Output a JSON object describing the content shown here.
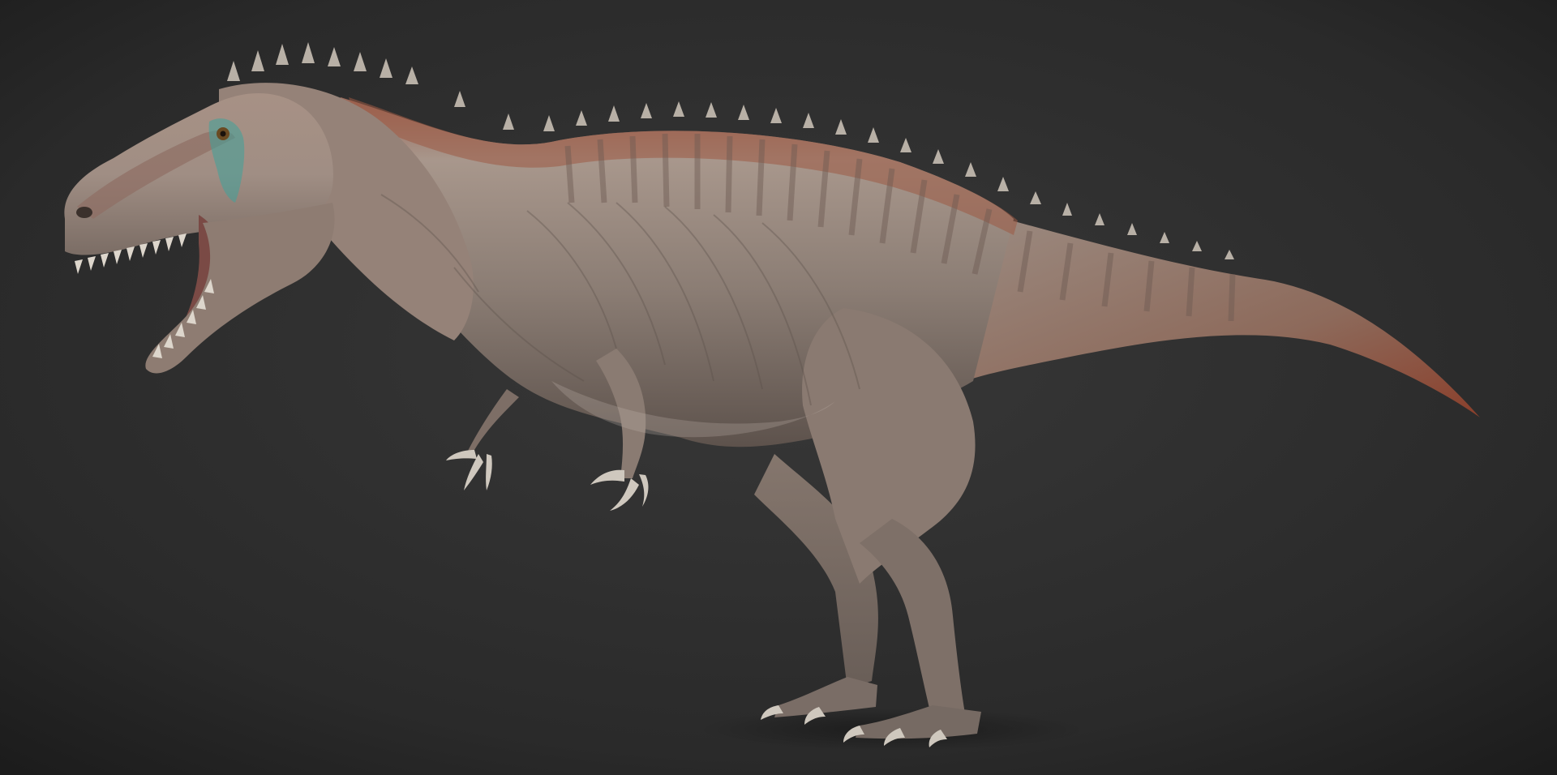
{
  "scene": {
    "subject": "dinosaur-render",
    "colors": {
      "background_center": "#353535",
      "background_edge": "#1c1c1c",
      "skin_light": "#b3a398",
      "skin_base": "#8a7a70",
      "skin_dark": "#5e524b",
      "back_stripe": "#a0553c",
      "belly_light": "#c8bcb2",
      "claw": "#c9c2b8",
      "eye_patch": "#3fa39b"
    }
  }
}
